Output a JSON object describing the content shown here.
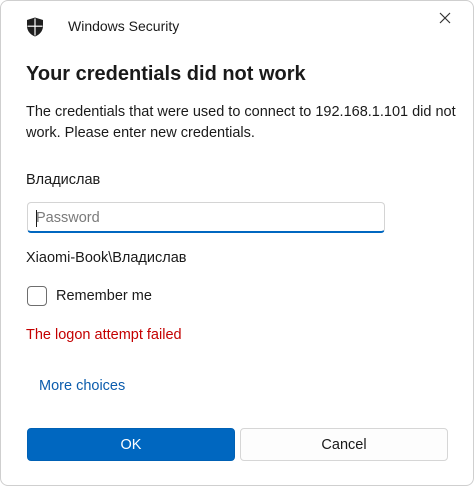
{
  "window": {
    "app_title": "Windows Security",
    "shield_icon": "shield-icon",
    "close_icon": "close-icon"
  },
  "content": {
    "heading": "Your credentials did not work",
    "message": "The credentials that were used to connect to 192.168.1.101 did not work. Please enter new credentials.",
    "username": "Владислав",
    "password": {
      "value": "",
      "placeholder": "Password"
    },
    "domain_user": "Xiaomi-Book\\Владислав",
    "remember_me": {
      "label": "Remember me",
      "checked": false
    },
    "error_text": "The logon attempt failed",
    "more_choices": "More choices"
  },
  "buttons": {
    "ok": "OK",
    "cancel": "Cancel"
  },
  "colors": {
    "accent": "#0067c0",
    "error": "#c40000",
    "link": "#0b5cad"
  }
}
